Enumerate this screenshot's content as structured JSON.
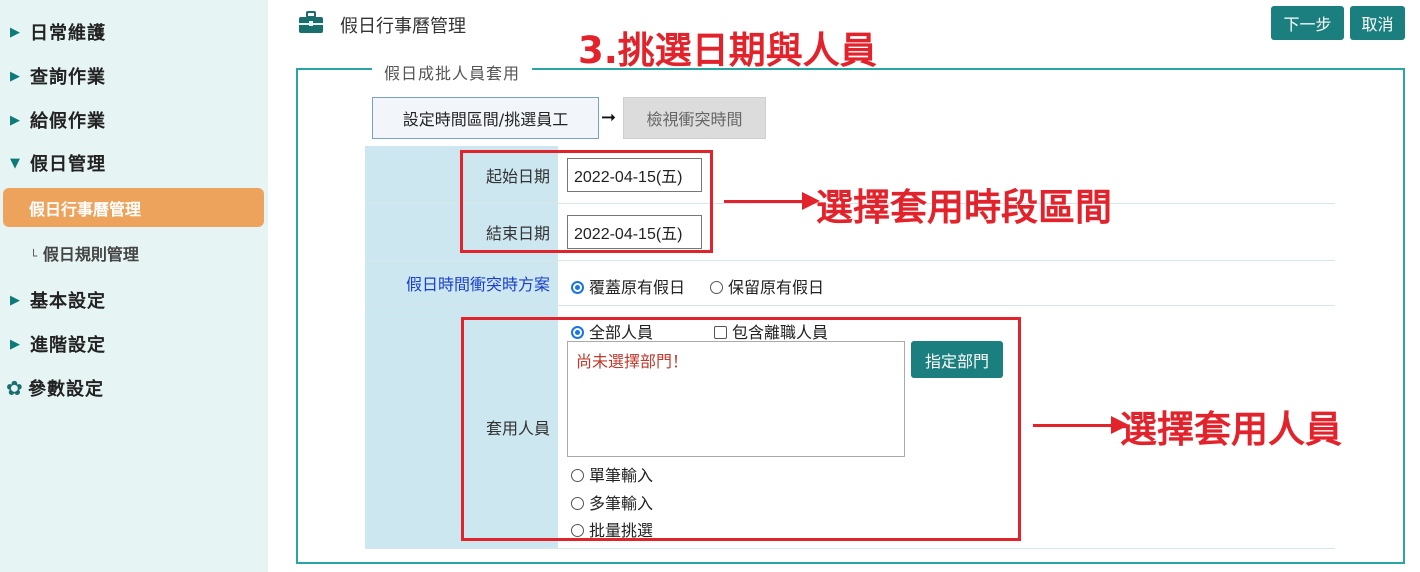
{
  "sidebar": {
    "items": [
      {
        "label": "日常維護"
      },
      {
        "label": "查詢作業"
      },
      {
        "label": "給假作業"
      },
      {
        "label": "假日管理"
      },
      {
        "label": "基本設定"
      },
      {
        "label": "進階設定"
      },
      {
        "label": "參數設定"
      }
    ],
    "sub_active": "假日行事曆管理",
    "sub_other": "假日規則管理",
    "sub_prefix": "└"
  },
  "header": {
    "title": "假日行事曆管理",
    "next_label": "下一步",
    "cancel_label": "取消"
  },
  "annotations": {
    "step_title": "3.挑選日期與人員",
    "date_note": "選擇套用時段區間",
    "people_note": "選擇套用人員"
  },
  "form": {
    "legend": "假日成批人員套用",
    "steps": [
      "設定時間區間/挑選員工",
      "檢視衝突時間"
    ],
    "start_label": "起始日期",
    "start_value": "2022-04-15(五)",
    "end_label": "結束日期",
    "end_value": "2022-04-15(五)",
    "conflict_label": "假日時間衝突時方案",
    "conflict_options": [
      "覆蓋原有假日",
      "保留原有假日"
    ],
    "conflict_selected": "覆蓋原有假日",
    "apply_label": "套用人員",
    "all_staff": "全部人員",
    "include_resigned": "包含離職人員",
    "dept_placeholder": "尚未選擇部門！",
    "assign_dept": "指定部門",
    "modes": [
      "單筆輸入",
      "多筆輸入",
      "批量挑選"
    ]
  },
  "colors": {
    "accent": "#1b7f7f",
    "sidebar_bg": "#e6f4f4",
    "active_item": "#eea35c",
    "annotation_red": "#e3232b"
  }
}
